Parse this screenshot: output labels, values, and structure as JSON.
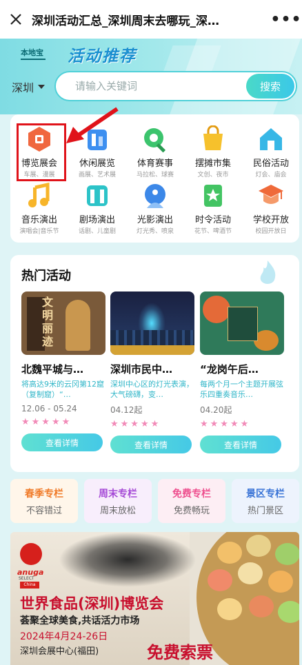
{
  "topbar": {
    "title": "深圳活动汇总_深圳周末去哪玩_深…",
    "more": "•••"
  },
  "header": {
    "logo": "本地宝",
    "banner_title": "活动推荐"
  },
  "search": {
    "city": "深圳",
    "placeholder": "请输入关键词",
    "button": "搜索"
  },
  "categories": [
    {
      "label": "博览展会",
      "sub": "车展、漫展",
      "icon": "expo-icon",
      "color": "#f0673f"
    },
    {
      "label": "休闲展览",
      "sub": "画展、艺术展",
      "icon": "exhibition-icon",
      "color": "#3d8ff0"
    },
    {
      "label": "体育赛事",
      "sub": "马拉松、球赛",
      "icon": "sports-icon",
      "color": "#3cc46d"
    },
    {
      "label": "摆摊市集",
      "sub": "文创、夜市",
      "icon": "market-icon",
      "color": "#f6c12c"
    },
    {
      "label": "民俗活动",
      "sub": "灯会、庙会",
      "icon": "folk-icon",
      "color": "#37b7e6"
    },
    {
      "label": "音乐演出",
      "sub": "演唱会|音乐节",
      "icon": "music-icon",
      "color": "#f7b52a"
    },
    {
      "label": "剧场演出",
      "sub": "话剧、儿童剧",
      "icon": "theater-icon",
      "color": "#2cc3c8"
    },
    {
      "label": "光影演出",
      "sub": "灯光秀、喷泉",
      "icon": "lightshow-icon",
      "color": "#3c88e8"
    },
    {
      "label": "时令活动",
      "sub": "花节、啤酒节",
      "icon": "seasonal-icon",
      "color": "#43c463"
    },
    {
      "label": "学校开放",
      "sub": "校园开放日",
      "icon": "school-icon",
      "color": "#ef6a3a"
    }
  ],
  "hot": {
    "title": "热门活动",
    "events": [
      {
        "name": "北魏平城与…",
        "desc": "将高达9米的云冈第12窟（复制窟）“…",
        "date": "12.06 - 05.24",
        "stars": "★★★★★",
        "button": "查看详情",
        "pic_text": "文明丽迹"
      },
      {
        "name": "深圳市民中…",
        "desc": "深圳中心区的灯光表演，大气磅礴，变…",
        "date": "04.12起",
        "stars": "★★★★★",
        "button": "查看详情",
        "pic_text": ""
      },
      {
        "name": "“龙岗午后…",
        "desc": "每两个月一个主题开展弦乐四重奏音乐…",
        "date": "04.20起",
        "stars": "★★★★★",
        "button": "查看详情",
        "pic_text": ""
      }
    ]
  },
  "columns": [
    {
      "title": "春季专栏",
      "sub": "不容错过",
      "color": "#f07a28",
      "bg": "#fff6ea"
    },
    {
      "title": "周末专栏",
      "sub": "周末放松",
      "color": "#a54ad6",
      "bg": "#f8eefc"
    },
    {
      "title": "免费专栏",
      "sub": "免费畅玩",
      "color": "#ee4f8e",
      "bg": "#fdeef4"
    },
    {
      "title": "景区专栏",
      "sub": "热门景区",
      "color": "#3a74d6",
      "bg": "#edf3fd"
    }
  ],
  "ad": {
    "brand": "anuga",
    "brand_sub": "SELECT",
    "brand_country": "China",
    "headline": "世界食品(深圳)博览会",
    "tagline": "荟聚全球美食,共话活力市场",
    "date": "2024年4月24-26日",
    "venue": "深圳会展中心(福田)",
    "free": "免费索票"
  }
}
